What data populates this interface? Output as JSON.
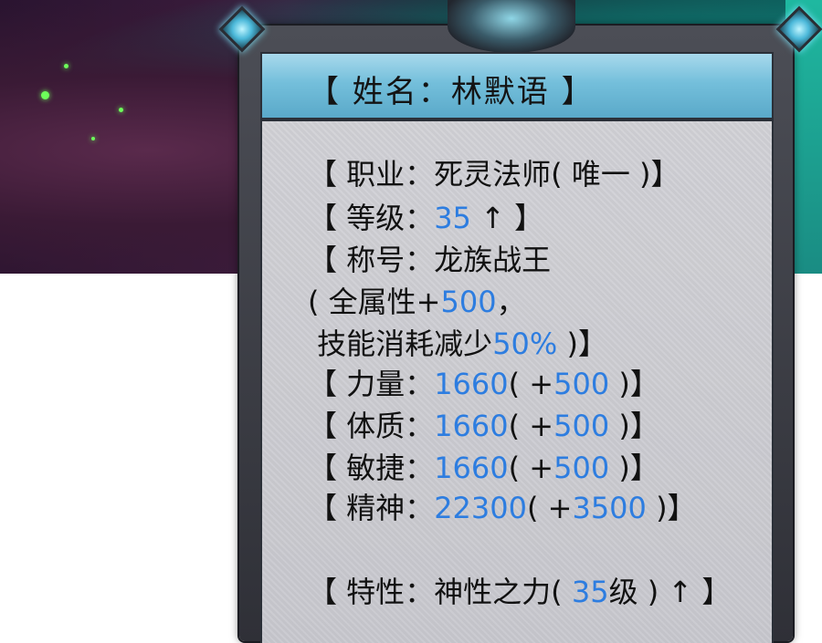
{
  "colors": {
    "number": "#2d7de0",
    "text": "#111111",
    "title_bar": "#74bfdb",
    "stone": "#cbcbd0"
  },
  "panel": {
    "title": "【 姓名：林默语 】",
    "lines": [
      {
        "a": "【 职业：死灵法师( 唯一 )】"
      },
      {
        "a": "【 等级：",
        "n1": "35",
        "b": " ↑ 】"
      },
      {
        "a": "【 称号：龙族战王"
      },
      {
        "a": "( 全属性+",
        "n1": "500",
        "b": "，"
      },
      {
        "a": " 技能消耗减少",
        "n1": "50%",
        "b": " )】"
      },
      {
        "a": "【 力量：",
        "n1": "1660",
        "b": "( +",
        "n2": "500",
        "c": " )】"
      },
      {
        "a": "【 体质：",
        "n1": "1660",
        "b": "( +",
        "n2": "500",
        "c": " )】"
      },
      {
        "a": "【 敏捷：",
        "n1": "1660",
        "b": "( +",
        "n2": "500",
        "c": " )】"
      },
      {
        "a": "【 精神：",
        "n1": "22300",
        "b": "( +",
        "n2": "3500",
        "c": " )】"
      },
      {
        "a": "【 特性：神性之力( ",
        "n1": "35",
        "b": "级 ) ↑ 】"
      }
    ]
  }
}
